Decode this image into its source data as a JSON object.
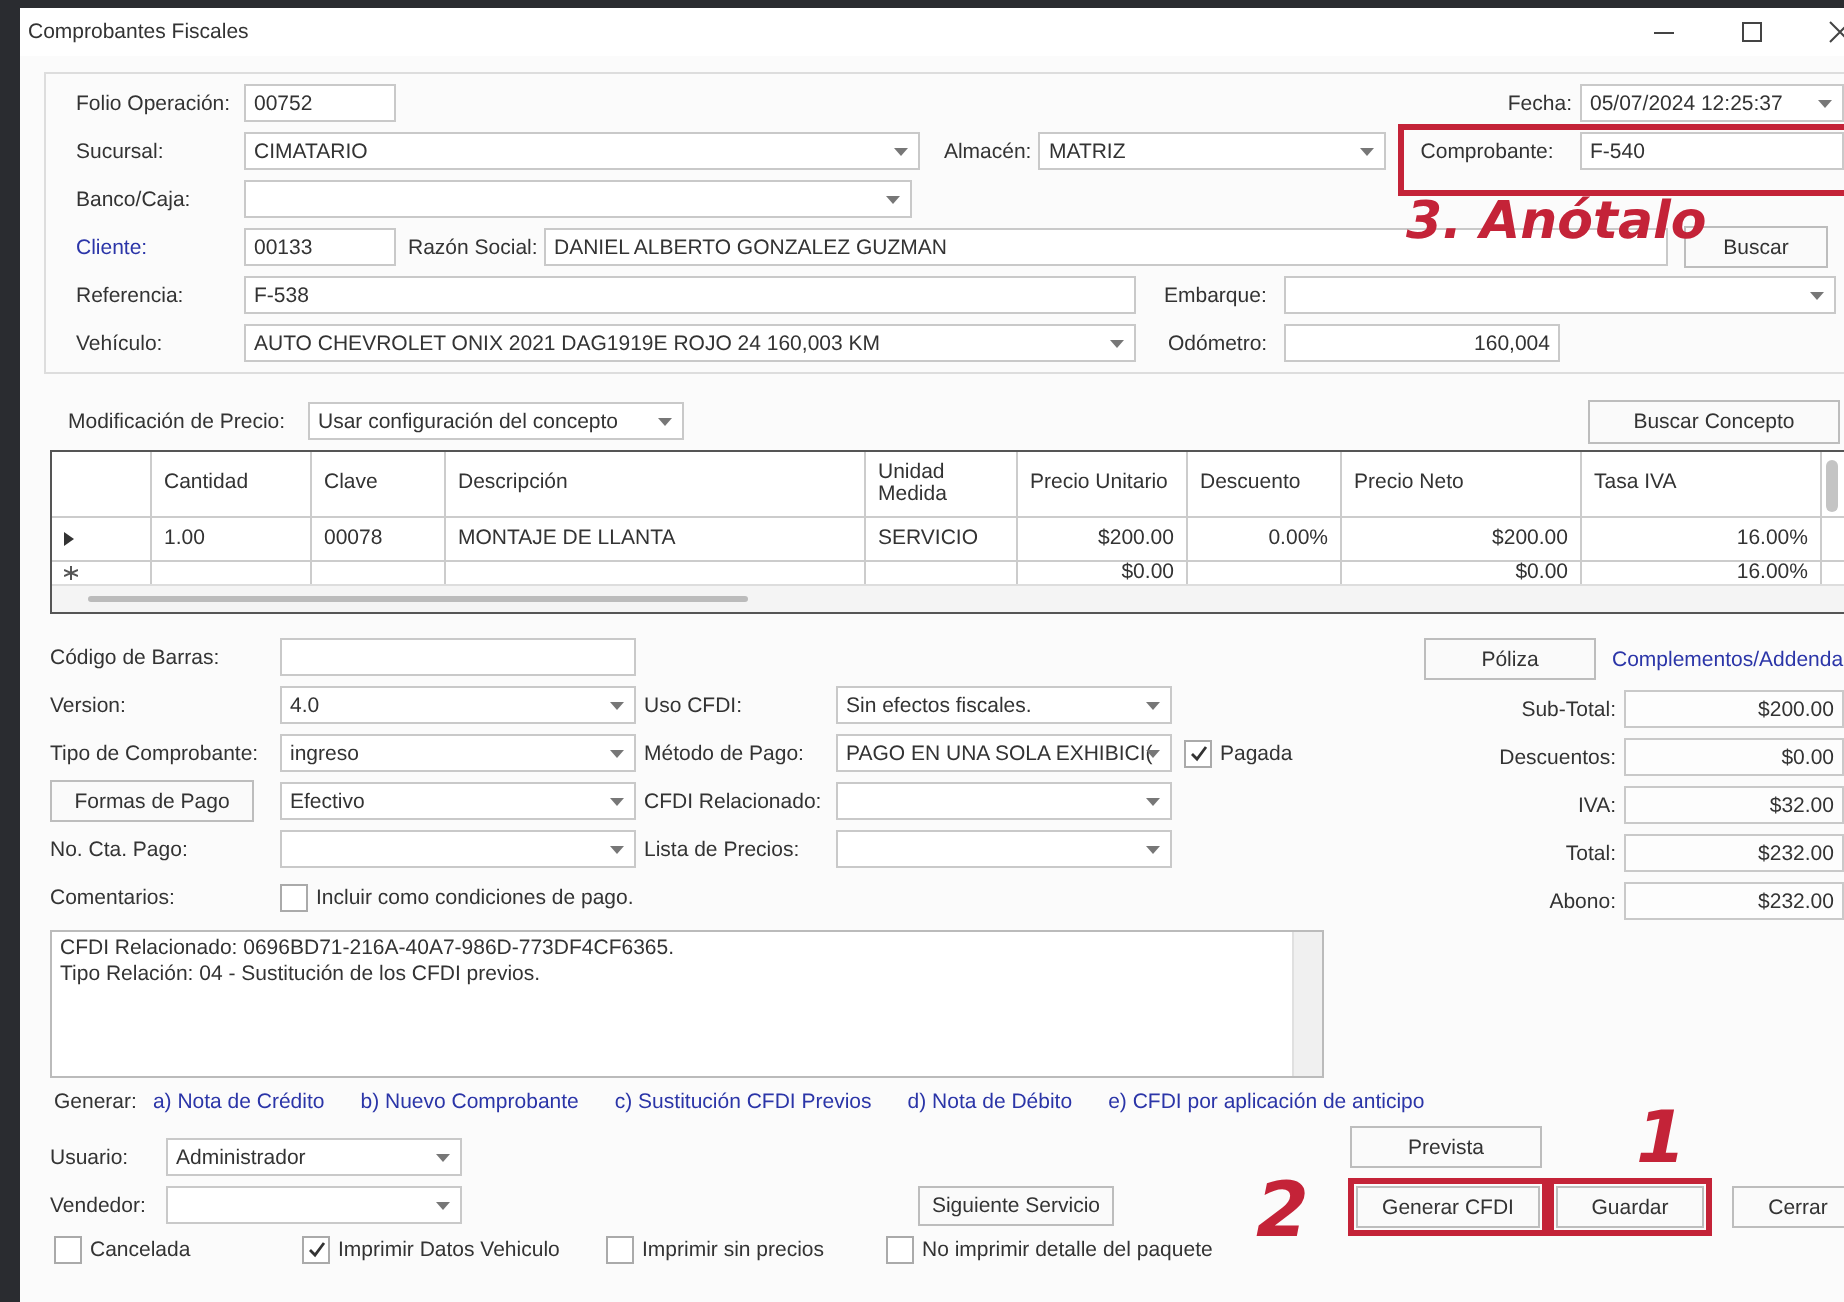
{
  "window": {
    "title": "Comprobantes Fiscales"
  },
  "header": {
    "folio": {
      "label": "Folio Operación:",
      "value": "00752",
      "kind": "text"
    },
    "fecha": {
      "label": "Fecha:",
      "value": "05/07/2024 12:25:37",
      "kind": "combo"
    },
    "sucursal": {
      "label": "Sucursal:",
      "value": "CIMATARIO",
      "kind": "combo"
    },
    "almacen": {
      "label": "Almacén:",
      "value": "MATRIZ",
      "kind": "combo"
    },
    "comprobante": {
      "label": "Comprobante:",
      "value": "F-540",
      "kind": "text"
    },
    "banco": {
      "label": "Banco/Caja:",
      "kind": "combo"
    },
    "cliente": {
      "label": "Cliente:",
      "value": "00133",
      "kind": "text"
    },
    "razon_social": {
      "label": "Razón Social:",
      "value": "DANIEL ALBERTO GONZALEZ GUZMAN",
      "kind": "text"
    },
    "buscar_button": "Buscar",
    "referencia": {
      "label": "Referencia:",
      "value": "F-538",
      "kind": "text"
    },
    "embarque": {
      "label": "Embarque:",
      "kind": "combo"
    },
    "vehiculo": {
      "label": "Vehículo:",
      "value": "AUTO CHEVROLET ONIX 2021 DAG1919E ROJO 24  160,003 KM",
      "kind": "combo"
    },
    "odometro": {
      "label": "Odómetro:",
      "value": "160,004",
      "kind": "text"
    }
  },
  "price_mode": {
    "label": "Modificación de Precio:",
    "value": "Usar configuración del concepto",
    "kind": "combo"
  },
  "buscar_concepto_button": "Buscar Concepto",
  "table": {
    "columns": [
      "Cantidad",
      "Clave",
      "Descripción",
      "Unidad Medida",
      "Precio Unitario",
      "Descuento",
      "Precio Neto",
      "Tasa IVA"
    ],
    "rows": [
      {
        "current": true,
        "cells": [
          "1.00",
          "00078",
          "MONTAJE DE LLANTA",
          "SERVICIO",
          "$200.00",
          "0.00%",
          "$200.00",
          "16.00%"
        ]
      },
      {
        "current": false,
        "cells": [
          "",
          "",
          "",
          "",
          "$0.00",
          "",
          "$0.00",
          "16.00%"
        ]
      }
    ]
  },
  "details": {
    "codigo": {
      "label": "Código de Barras:",
      "kind": "text"
    },
    "version": {
      "label": "Version:",
      "value": "4.0",
      "kind": "combo"
    },
    "tipo": {
      "label": "Tipo de Comprobante:",
      "value": "ingreso",
      "kind": "combo"
    },
    "formas_pago_button": "Formas de Pago",
    "forma": {
      "value": "Efectivo",
      "kind": "combo"
    },
    "cuenta": {
      "label": "No. Cta. Pago:",
      "kind": "combo"
    },
    "uso": {
      "label": "Uso CFDI:",
      "value": "Sin efectos fiscales.",
      "kind": "combo"
    },
    "metodo": {
      "label": "Método de Pago:",
      "value": "PAGO EN UNA SOLA EXHIBICI(",
      "kind": "combo"
    },
    "pagada": {
      "label": "Pagada",
      "checked": true
    },
    "relacionado": {
      "label": "CFDI Relacionado:",
      "kind": "combo"
    },
    "lista": {
      "label": "Lista de Precios:",
      "kind": "combo"
    },
    "comentarios_label": "Comentarios:",
    "incluir": {
      "label": "Incluir como condiciones de pago.",
      "checked": false
    },
    "comentarios": "CFDI Relacionado: 0696BD71-216A-40A7-986D-773DF4CF6365.\nTipo Relación: 04 - Sustitución de los CFDI previos."
  },
  "poliza_button": "Póliza",
  "complementos_link": "Complementos/Addenda",
  "totals": [
    {
      "label": "Sub-Total:",
      "value": "$200.00"
    },
    {
      "label": "Descuentos:",
      "value": "$0.00"
    },
    {
      "label": "IVA:",
      "value": "$32.00"
    },
    {
      "label": "Total:",
      "value": "$232.00"
    },
    {
      "label": "Abono:",
      "value": "$232.00"
    }
  ],
  "generar": {
    "label": "Generar:",
    "links": [
      "a) Nota de Crédito",
      "b) Nuevo Comprobante",
      "c) Sustitución CFDI Previos",
      "d) Nota de Débito",
      "e)  CFDI por aplicación de anticipo"
    ]
  },
  "usuario": {
    "label": "Usuario:",
    "value": "Administrador",
    "kind": "combo"
  },
  "vendedor": {
    "label": "Vendedor:",
    "kind": "combo"
  },
  "buttons": {
    "prevista": "Prevista",
    "siguiente": "Siguiente Servicio",
    "generar_cfdi": "Generar CFDI",
    "guardar": "Guardar",
    "cerrar": "Cerrar"
  },
  "print_options": [
    {
      "label": "Cancelada",
      "checked": false
    },
    {
      "label": "Imprimir Datos Vehiculo",
      "checked": true
    },
    {
      "label": "Imprimir sin precios",
      "checked": false
    },
    {
      "label": "No imprimir detalle del paquete",
      "checked": false
    }
  ],
  "annotations": {
    "note": "3. Anótalo",
    "step_2": "2",
    "step_1": "1"
  }
}
